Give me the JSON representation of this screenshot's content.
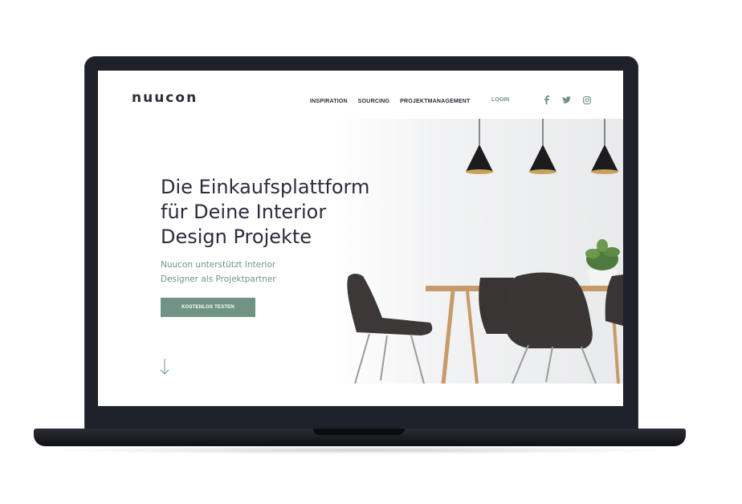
{
  "site": {
    "logo": "nuucon",
    "nav": [
      "INSPIRATION",
      "SOURCING",
      "PROJEKTMANAGEMENT"
    ],
    "login_label": "LOGIN",
    "social_icons": [
      "facebook-icon",
      "twitter-icon",
      "instagram-icon"
    ]
  },
  "hero": {
    "headline": [
      "Die Einkaufsplattform",
      "für Deine Interior",
      "Design Projekte"
    ],
    "subheadline": [
      "Nuucon unterstützt Interior",
      "Designer als Projektpartner"
    ],
    "cta_label": "KOSTENLOS TESTEN"
  },
  "colors": {
    "accent": "#6f9485",
    "text_dark": "#2b2d3a",
    "laptop_body": "#1f2128"
  }
}
